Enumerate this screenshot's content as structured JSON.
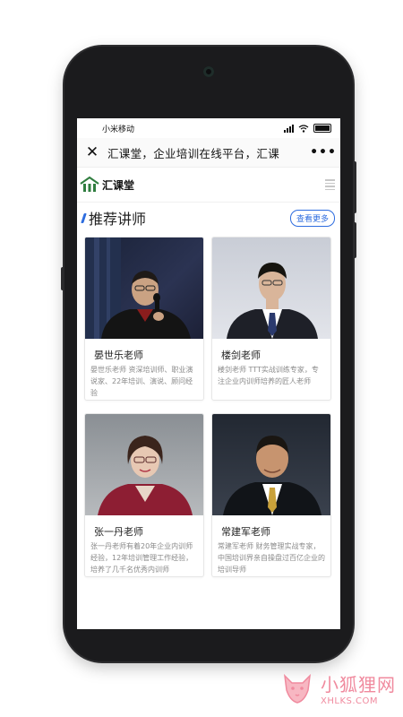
{
  "status_bar": {
    "carrier": "小米移动"
  },
  "browser_bar": {
    "title": "汇课堂，企业培训在线平台，汇课"
  },
  "site_header": {
    "logo_text": "汇课堂"
  },
  "section": {
    "title": "推荐讲师",
    "more_label": "查看更多"
  },
  "teachers": [
    {
      "name": "晏世乐老师",
      "desc": "晏世乐老师 资深培训师、职业演说家、22年培训、演说、顾问经验"
    },
    {
      "name": "楼剑老师",
      "desc": "楼剑老师 TTT实战训练专家，专注企业内训师培养的匠人老师"
    },
    {
      "name": "张一丹老师",
      "desc": "张一丹老师有着20年企业内训师经验，12年培训管理工作经验，培养了几千名优秀内训师"
    },
    {
      "name": "常建军老师",
      "desc": "常建军老师 财务管理实战专家，中国培训界亲自操盘过百亿企业的培训导师"
    }
  ],
  "watermark": {
    "cn": "小狐狸网",
    "en": "XHLKS.COM"
  },
  "colors": {
    "accent": "#2d6cdf",
    "logo_green": "#2f7d3f",
    "watermark": "#f08a9e"
  },
  "icons": {
    "close": "close-icon",
    "more": "more-icon",
    "menu": "menu-icon"
  }
}
